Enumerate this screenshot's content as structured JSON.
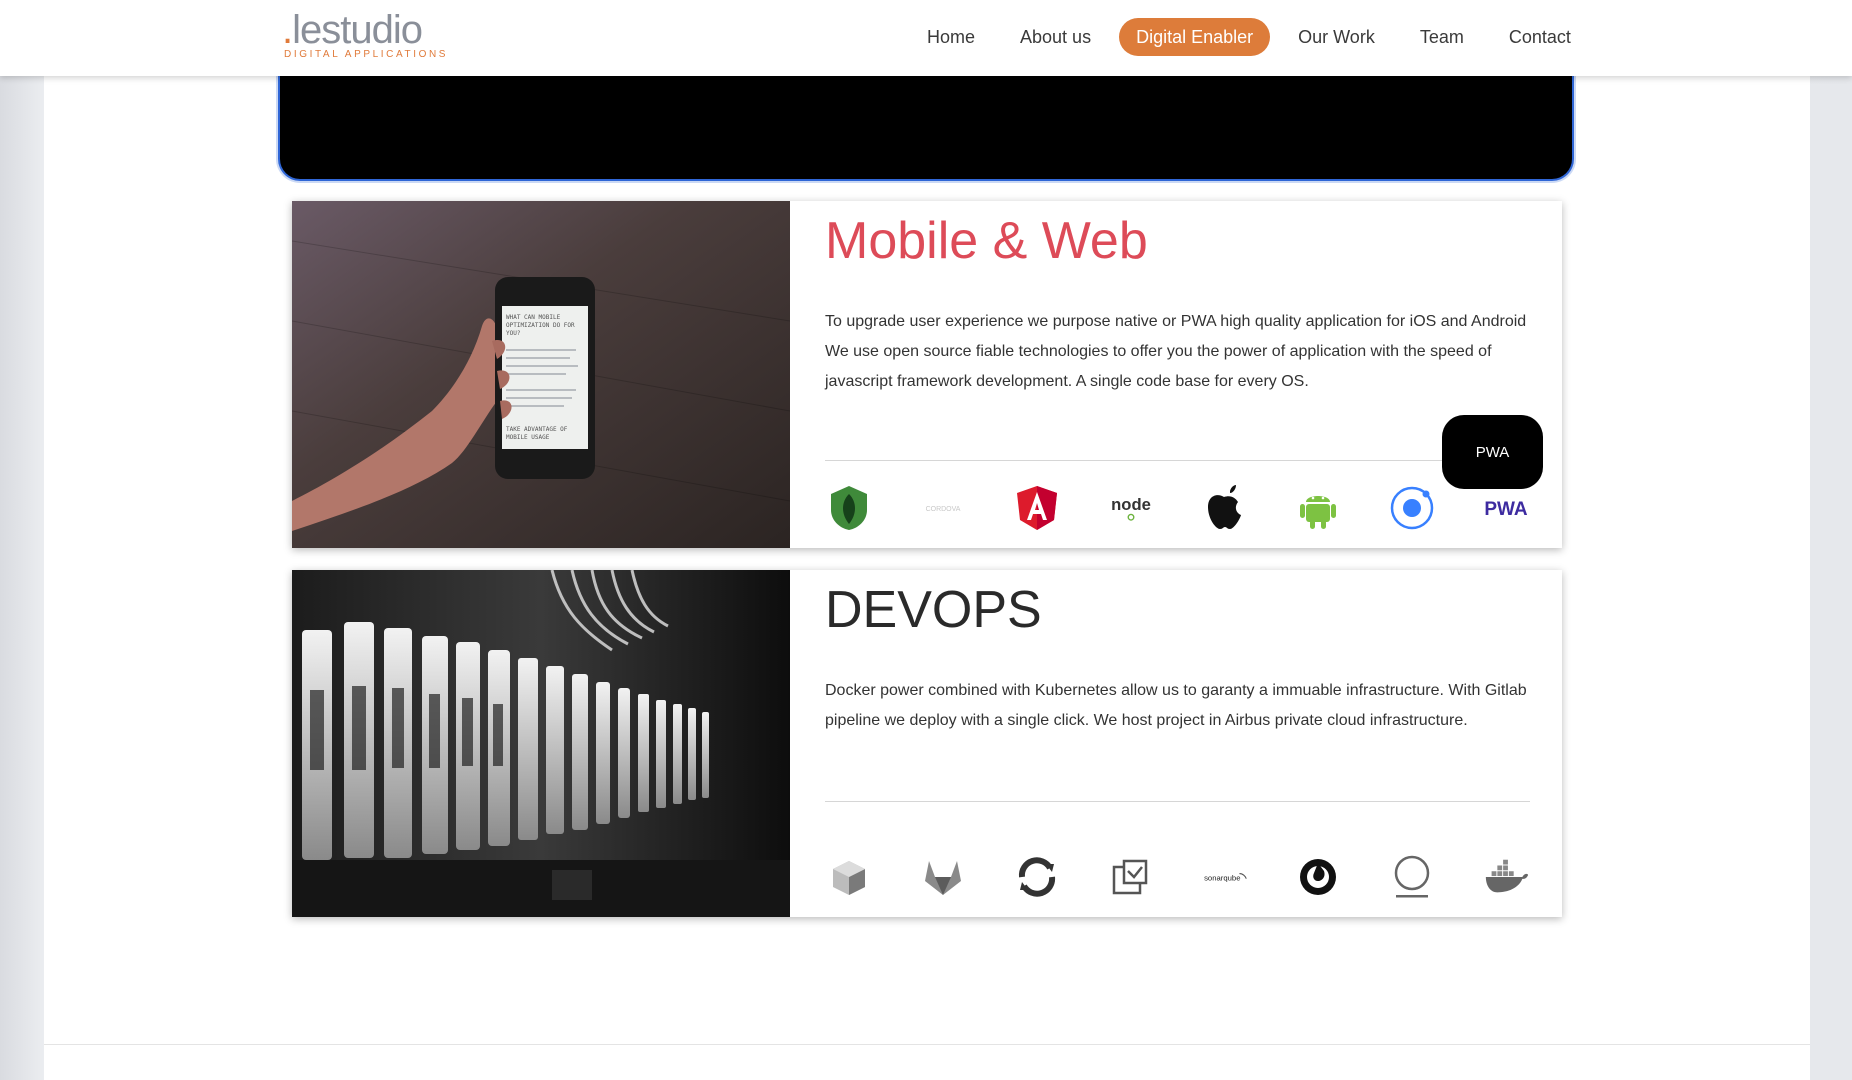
{
  "header": {
    "logo": {
      "dot": ".",
      "word": "lestudio",
      "tagline": "DIGITAL APPLICATIONS"
    },
    "nav": [
      {
        "label": "Home",
        "active": false
      },
      {
        "label": "About us",
        "active": false
      },
      {
        "label": "Digital Enabler",
        "active": true
      },
      {
        "label": "Our Work",
        "active": false
      },
      {
        "label": "Team",
        "active": false
      },
      {
        "label": "Contact",
        "active": false
      }
    ]
  },
  "colors": {
    "accent": "#dd7c3a",
    "mobile_title": "#dd4b58",
    "video_border": "#2f66d6"
  },
  "mobile": {
    "title": "Mobile & Web",
    "text": "To upgrade user experience we purpose native or PWA high quality application for iOS and Android We use open source fiable technologies to offer you the power of application with the speed of javascript framework development. A single code base for every OS.",
    "image_phone_text": [
      "WHAT CAN MOBILE",
      "OPTIMIZATION DO FOR",
      "YOU?",
      "TAKE ADVANTAGE OF",
      "MOBILE USAGE"
    ],
    "logos": [
      {
        "name": "mongodb-icon"
      },
      {
        "name": "cordova-icon",
        "label": "CORDOVA"
      },
      {
        "name": "angular-icon"
      },
      {
        "name": "nodejs-icon",
        "label": "node"
      },
      {
        "name": "apple-icon"
      },
      {
        "name": "android-icon"
      },
      {
        "name": "ionic-icon"
      },
      {
        "name": "pwa-icon",
        "label": "PWA"
      }
    ],
    "tooltip": "PWA"
  },
  "devops": {
    "title": "DEVOPS",
    "text": "Docker power combined with Kubernetes allow us to garanty a immuable infrastructure. With Gitlab pipeline we deploy with a single click. We host project in Airbus private cloud infrastructure.",
    "logos": [
      {
        "name": "box-icon"
      },
      {
        "name": "gitlab-icon"
      },
      {
        "name": "openshift-icon"
      },
      {
        "name": "registry-icon"
      },
      {
        "name": "sonarqube-icon",
        "label": "sonarqube"
      },
      {
        "name": "mattermost-icon"
      },
      {
        "name": "circle-icon"
      },
      {
        "name": "docker-icon"
      }
    ]
  }
}
